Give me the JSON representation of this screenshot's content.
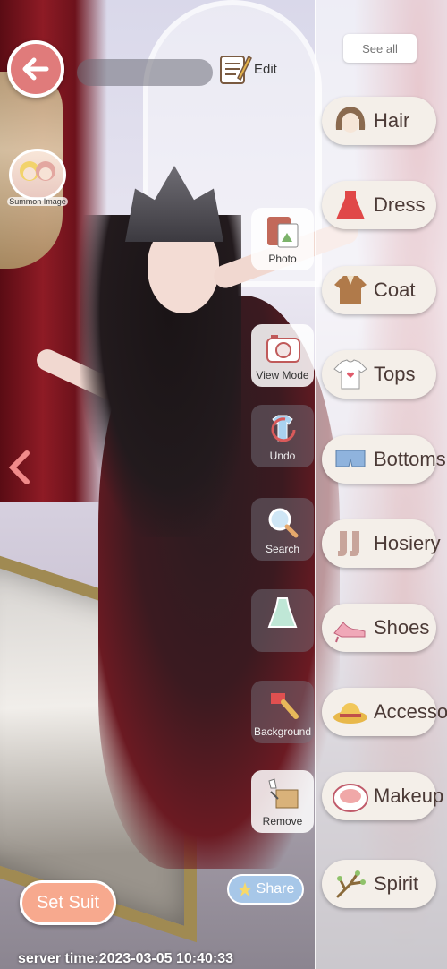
{
  "topbar": {
    "edit_label": "Edit"
  },
  "summon": {
    "label": "Summon Image"
  },
  "tools": {
    "photo": "Photo",
    "view_mode": "View Mode",
    "undo": "Undo",
    "search": "Search",
    "background": "Background",
    "remove": "Remove"
  },
  "panel": {
    "see_all": "See all",
    "categories": [
      {
        "label": "Hair",
        "icon": "hair-icon"
      },
      {
        "label": "Dress",
        "icon": "dress-icon"
      },
      {
        "label": "Coat",
        "icon": "coat-icon"
      },
      {
        "label": "Tops",
        "icon": "tops-icon"
      },
      {
        "label": "Bottoms",
        "icon": "bottoms-icon"
      },
      {
        "label": "Hosiery",
        "icon": "hosiery-icon"
      },
      {
        "label": "Shoes",
        "icon": "shoes-icon"
      },
      {
        "label": "Accessory",
        "icon": "accessory-icon"
      },
      {
        "label": "Makeup",
        "icon": "makeup-icon"
      },
      {
        "label": "Spirit",
        "icon": "spirit-icon"
      }
    ]
  },
  "bottom": {
    "set_suit": "Set Suit",
    "share": "Share",
    "server_time": "server time:2023-03-05 10:40:33"
  },
  "colors": {
    "back_button": "#e07b7b",
    "set_suit": "#f7a98e",
    "share": "#a7c7e8"
  }
}
